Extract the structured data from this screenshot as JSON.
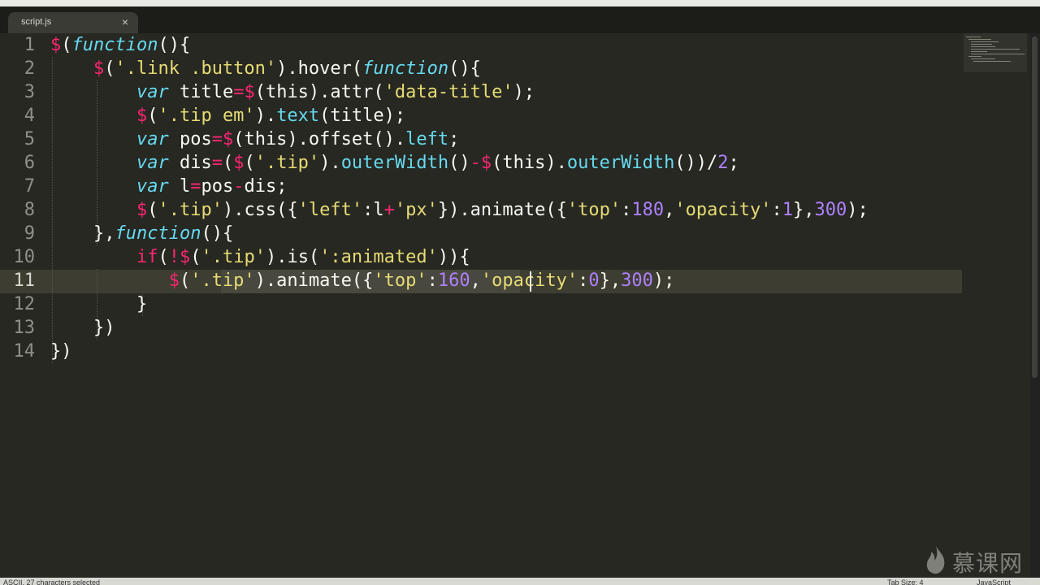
{
  "tab": {
    "label": "script.js",
    "close_symbol": "×"
  },
  "lines": [
    {
      "number": "1",
      "tokens": [
        {
          "c": "k",
          "t": "$"
        },
        {
          "c": "p",
          "t": "("
        },
        {
          "c": "i",
          "t": "function"
        },
        {
          "c": "p",
          "t": "(){"
        }
      ]
    },
    {
      "number": "2",
      "tokens": [
        {
          "c": "p",
          "t": "    "
        },
        {
          "c": "k",
          "t": "$"
        },
        {
          "c": "p",
          "t": "("
        },
        {
          "c": "s",
          "t": "'.link .button'"
        },
        {
          "c": "p",
          "t": ").hover("
        },
        {
          "c": "i",
          "t": "function"
        },
        {
          "c": "p",
          "t": "(){"
        }
      ]
    },
    {
      "number": "3",
      "tokens": [
        {
          "c": "p",
          "t": "        "
        },
        {
          "c": "i",
          "t": "var"
        },
        {
          "c": "p",
          "t": " title"
        },
        {
          "c": "k",
          "t": "="
        },
        {
          "c": "k",
          "t": "$"
        },
        {
          "c": "p",
          "t": "(this).attr("
        },
        {
          "c": "s",
          "t": "'data-title'"
        },
        {
          "c": "p",
          "t": ");"
        }
      ]
    },
    {
      "number": "4",
      "tokens": [
        {
          "c": "p",
          "t": "        "
        },
        {
          "c": "k",
          "t": "$"
        },
        {
          "c": "p",
          "t": "("
        },
        {
          "c": "s",
          "t": "'.tip em'"
        },
        {
          "c": "p",
          "t": ")."
        },
        {
          "c": "c",
          "t": "text"
        },
        {
          "c": "p",
          "t": "(title);"
        }
      ]
    },
    {
      "number": "5",
      "tokens": [
        {
          "c": "p",
          "t": "        "
        },
        {
          "c": "i",
          "t": "var"
        },
        {
          "c": "p",
          "t": " pos"
        },
        {
          "c": "k",
          "t": "="
        },
        {
          "c": "k",
          "t": "$"
        },
        {
          "c": "p",
          "t": "(this).offset()."
        },
        {
          "c": "c",
          "t": "left"
        },
        {
          "c": "p",
          "t": ";"
        }
      ]
    },
    {
      "number": "6",
      "tokens": [
        {
          "c": "p",
          "t": "        "
        },
        {
          "c": "i",
          "t": "var"
        },
        {
          "c": "p",
          "t": " dis"
        },
        {
          "c": "k",
          "t": "="
        },
        {
          "c": "p",
          "t": "("
        },
        {
          "c": "k",
          "t": "$"
        },
        {
          "c": "p",
          "t": "("
        },
        {
          "c": "s",
          "t": "'.tip'"
        },
        {
          "c": "p",
          "t": ")."
        },
        {
          "c": "c",
          "t": "outerWidth"
        },
        {
          "c": "p",
          "t": "()"
        },
        {
          "c": "k",
          "t": "-"
        },
        {
          "c": "k",
          "t": "$"
        },
        {
          "c": "p",
          "t": "(this)."
        },
        {
          "c": "c",
          "t": "outerWidth"
        },
        {
          "c": "p",
          "t": "())/"
        },
        {
          "c": "n",
          "t": "2"
        },
        {
          "c": "p",
          "t": ";"
        }
      ]
    },
    {
      "number": "7",
      "tokens": [
        {
          "c": "p",
          "t": "        "
        },
        {
          "c": "i",
          "t": "var"
        },
        {
          "c": "p",
          "t": " l"
        },
        {
          "c": "k",
          "t": "="
        },
        {
          "c": "p",
          "t": "pos"
        },
        {
          "c": "k",
          "t": "-"
        },
        {
          "c": "p",
          "t": "dis;"
        }
      ]
    },
    {
      "number": "8",
      "tokens": [
        {
          "c": "p",
          "t": "        "
        },
        {
          "c": "k",
          "t": "$"
        },
        {
          "c": "p",
          "t": "("
        },
        {
          "c": "s",
          "t": "'.tip'"
        },
        {
          "c": "p",
          "t": ").css({"
        },
        {
          "c": "s",
          "t": "'left'"
        },
        {
          "c": "p",
          "t": ":l"
        },
        {
          "c": "k",
          "t": "+"
        },
        {
          "c": "s",
          "t": "'px'"
        },
        {
          "c": "p",
          "t": "}).animate({"
        },
        {
          "c": "s",
          "t": "'top'"
        },
        {
          "c": "p",
          "t": ":"
        },
        {
          "c": "n",
          "t": "180"
        },
        {
          "c": "p",
          "t": ","
        },
        {
          "c": "s",
          "t": "'opacity'"
        },
        {
          "c": "p",
          "t": ":"
        },
        {
          "c": "n",
          "t": "1"
        },
        {
          "c": "p",
          "t": "},"
        },
        {
          "c": "n",
          "t": "300"
        },
        {
          "c": "p",
          "t": ");"
        }
      ]
    },
    {
      "number": "9",
      "tokens": [
        {
          "c": "p",
          "t": "    },"
        },
        {
          "c": "i",
          "t": "function"
        },
        {
          "c": "p",
          "t": "(){"
        }
      ]
    },
    {
      "number": "10",
      "tokens": [
        {
          "c": "p",
          "t": "        "
        },
        {
          "c": "k",
          "t": "if"
        },
        {
          "c": "p",
          "t": "("
        },
        {
          "c": "k",
          "t": "!"
        },
        {
          "c": "k",
          "t": "$"
        },
        {
          "c": "p",
          "t": "("
        },
        {
          "c": "s",
          "t": "'.tip'"
        },
        {
          "c": "p",
          "t": ").is("
        },
        {
          "c": "s",
          "t": "':animated'"
        },
        {
          "c": "p",
          "t": ")){"
        }
      ]
    },
    {
      "number": "11",
      "tokens": [
        {
          "c": "p",
          "t": "           "
        },
        {
          "c": "k",
          "t": "$"
        },
        {
          "c": "p",
          "t": "("
        },
        {
          "c": "s",
          "t": "'.tip'"
        },
        {
          "c": "p",
          "t": ").animate({"
        },
        {
          "c": "s",
          "t": "'top'"
        },
        {
          "c": "p",
          "t": ":"
        },
        {
          "c": "n",
          "t": "160"
        },
        {
          "c": "p",
          "t": ","
        },
        {
          "c": "s",
          "t": "'opacity'"
        },
        {
          "c": "p",
          "t": ":"
        },
        {
          "c": "n",
          "t": "0"
        },
        {
          "c": "p",
          "t": "},"
        },
        {
          "c": "n",
          "t": "300"
        },
        {
          "c": "p",
          "t": ");"
        }
      ]
    },
    {
      "number": "12",
      "tokens": [
        {
          "c": "p",
          "t": "        }"
        }
      ]
    },
    {
      "number": "13",
      "tokens": [
        {
          "c": "p",
          "t": "    })"
        }
      ]
    },
    {
      "number": "14",
      "tokens": [
        {
          "c": "p",
          "t": "})"
        }
      ]
    }
  ],
  "active_line": "11",
  "status": {
    "left": "ASCII, 27 characters selected",
    "tab_size": "Tab Size: 4",
    "syntax": "JavaScript"
  },
  "colors": {
    "background": "#272822",
    "keyword": "#f92672",
    "string": "#e6db74",
    "number": "#ae81ff",
    "storage": "#66d9ef",
    "foreground": "#f8f8f2"
  },
  "watermark": {
    "text": "慕课网"
  }
}
